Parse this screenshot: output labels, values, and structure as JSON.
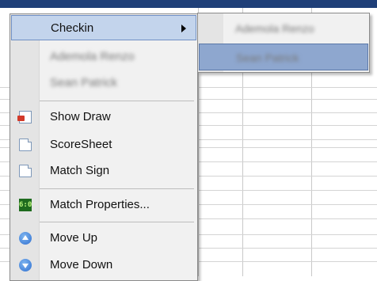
{
  "context_menu": {
    "checkin_label": "Checkin",
    "player_1_label": "Ademola Renzo",
    "player_2_label": "Sean Patrick",
    "show_draw_label": "Show Draw",
    "score_sheet_label": "ScoreSheet",
    "match_sign_label": "Match Sign",
    "match_properties_label": "Match Properties...",
    "move_up_label": "Move Up",
    "move_down_label": "Move Down",
    "score_icon_text": "6:0"
  },
  "submenu": {
    "player_1_label": "Ademola Renzo",
    "player_2_label": "Sean Patrick"
  },
  "icons": {
    "show_draw": "draw-icon",
    "score_sheet": "document-icon",
    "match_sign": "document-icon",
    "match_properties": "scoreboard-icon",
    "move_up": "arrow-up-circle-icon",
    "move_down": "arrow-down-circle-icon",
    "submenu": "triangle-right-icon"
  },
  "colors": {
    "highlight": "#c3d4ec",
    "submenu_highlight": "#8ea7cf",
    "menu_background": "#f1f1f1",
    "header_strip": "#1f3f78"
  }
}
